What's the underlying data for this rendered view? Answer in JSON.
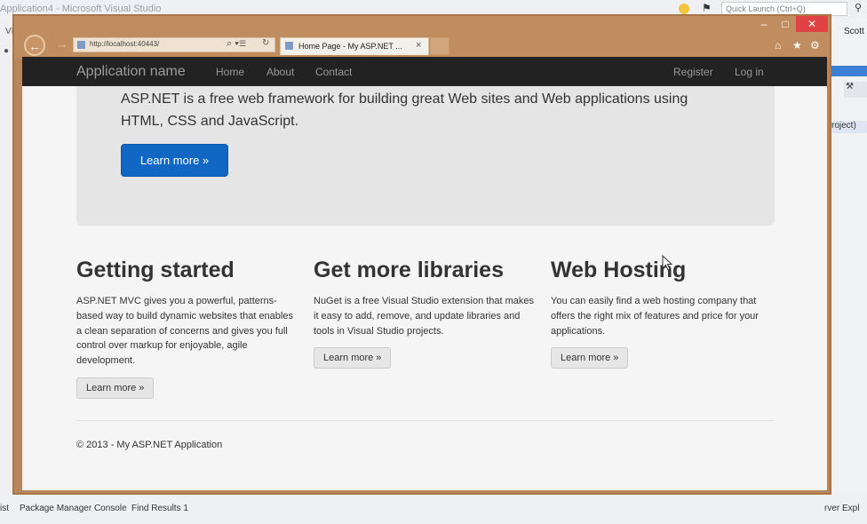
{
  "vs": {
    "title": "Application4 - Microsoft Visual Studio",
    "quick_launch": "Quick Launch (Ctrl+Q)",
    "left_labels": [
      "VI",
      "●"
    ],
    "right_user": "Scott",
    "right_tool": "⚒",
    "right_project": "roject)",
    "bottom_tabs": [
      "ist",
      "Package Manager Console",
      "Find Results 1",
      "rver Expl"
    ]
  },
  "browser": {
    "url": "http://localhost:40443/",
    "tab_title": "Home Page - My ASP.NET ...",
    "tab_close": "×",
    "back": "←",
    "forward": "→",
    "search_glyph": "⌕ ▾",
    "compat_glyph": "☰",
    "refresh_glyph": "↻",
    "min": "–",
    "max": "□",
    "close": "✕",
    "home_glyph": "⌂",
    "star_glyph": "★",
    "gear_glyph": "⚙"
  },
  "site": {
    "brand": "Application name",
    "nav": {
      "home": "Home",
      "about": "About",
      "contact": "Contact",
      "register": "Register",
      "login": "Log in"
    },
    "jumbotron": {
      "lead": "ASP.NET is a free web framework for building great Web sites and Web applications using HTML, CSS and JavaScript.",
      "button": "Learn more »"
    },
    "columns": [
      {
        "heading": "Getting started",
        "body": "ASP.NET MVC gives you a powerful, patterns-based way to build dynamic websites that enables a clean separation of concerns and gives you full control over markup for enjoyable, agile development.",
        "button": "Learn more »"
      },
      {
        "heading": "Get more libraries",
        "body": "NuGet is a free Visual Studio extension that makes it easy to add, remove, and update libraries and tools in Visual Studio projects.",
        "button": "Learn more »"
      },
      {
        "heading": "Web Hosting",
        "body": "You can easily find a web hosting company that offers the right mix of features and price for your applications.",
        "button": "Learn more »"
      }
    ],
    "footer": "© 2013 - My ASP.NET Application"
  }
}
